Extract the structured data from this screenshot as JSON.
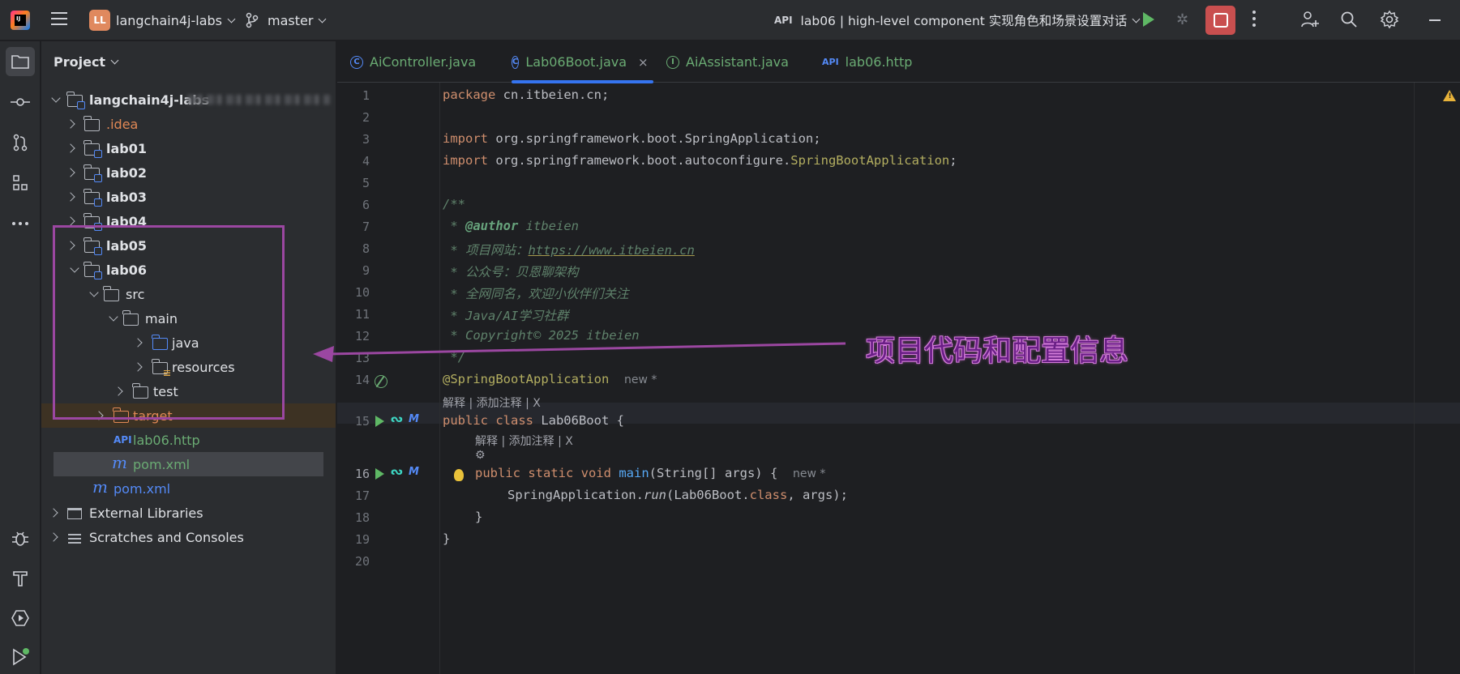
{
  "titlebar": {
    "app_logo": "jetbrains-idea-logo",
    "project_initials": "LL",
    "project_name": "langchain4j-labs",
    "branch": "master",
    "run_config": "lab06 | high-level component 实现角色和场景设置对话",
    "icons": [
      "menu-icon",
      "branch-icon",
      "run-icon",
      "debug-icon",
      "stop-icon",
      "more-icon",
      "add-user-icon",
      "search-icon",
      "settings-icon",
      "minimize-icon"
    ]
  },
  "toolstrip": {
    "icons": [
      "folder-icon",
      "commit-icon",
      "pull-request-icon",
      "structure-icon",
      "more-icon",
      "debug-icon",
      "build-icon",
      "services-icon",
      "run-icon"
    ]
  },
  "project": {
    "header": "Project",
    "root": "langchain4j-labs",
    "items": [
      ".idea",
      "lab01",
      "lab02",
      "lab03",
      "lab04",
      "lab05",
      "lab06",
      "src",
      "main",
      "java",
      "resources",
      "test",
      "target",
      "lab06.http",
      "pom.xml",
      "pom.xml",
      "External Libraries",
      "Scratches and Consoles"
    ]
  },
  "editor": {
    "tabs": [
      {
        "label": "AiController.java",
        "icon": "class-icon",
        "icon_letter": "C"
      },
      {
        "label": "Lab06Boot.java",
        "icon": "spring-class-icon",
        "icon_letter": "C",
        "active": true
      },
      {
        "label": "AiAssistant.java",
        "icon": "interface-icon",
        "icon_letter": "I"
      },
      {
        "label": "lab06.http",
        "icon": "http-icon",
        "icon_letter": "API"
      }
    ],
    "tab_close": "×",
    "lines": [
      "1",
      "2",
      "3",
      "4",
      "5",
      "6",
      "7",
      "8",
      "9",
      "10",
      "11",
      "12",
      "13",
      "14",
      "15",
      "16",
      "17",
      "18",
      "19",
      "20"
    ],
    "code": {
      "l1a": "package",
      "l1b": " cn.itbeien.cn;",
      "l3a": "import",
      "l3b": " org.springframework.boot.SpringApplication;",
      "l4a": "import",
      "l4b": " org.springframework.boot.autoconfigure.",
      "l4c": "SpringBootApplication",
      "l4d": ";",
      "l6": "/**",
      "l7a": " * ",
      "l7b": "@author",
      "l7c": " itbeien",
      "l8a": " * 项目网站：",
      "l8b": "https://www.itbeien.cn",
      "l9": " * 公众号：贝恩聊架构",
      "l10": " * 全网同名，欢迎小伙伴们关注",
      "l11": " * Java/AI学习社群",
      "l12": " * Copyright© 2025 itbeien",
      "l13": " */",
      "l14a": "@SpringBootApplication",
      "l14hint": "new *",
      "lens1": "解释 | 添加注释 | X",
      "l15a": "public class",
      "l15b": " Lab06Boot {",
      "lens2": "解释 | 添加注释 | X",
      "lens2b": "⚙",
      "l16a": "public static void",
      "l16b": " ",
      "l16c": "main",
      "l16d": "(String[] args) {",
      "l16hint": "new *",
      "l17a": "SpringApplication.",
      "l17b": "run",
      "l17c": "(Lab06Boot.",
      "l17d": "class",
      "l17e": ", args);",
      "l18": "}",
      "l19": "}"
    }
  },
  "annotation": {
    "text": "项目代码和配置信息",
    "color": "#9b47a1"
  }
}
